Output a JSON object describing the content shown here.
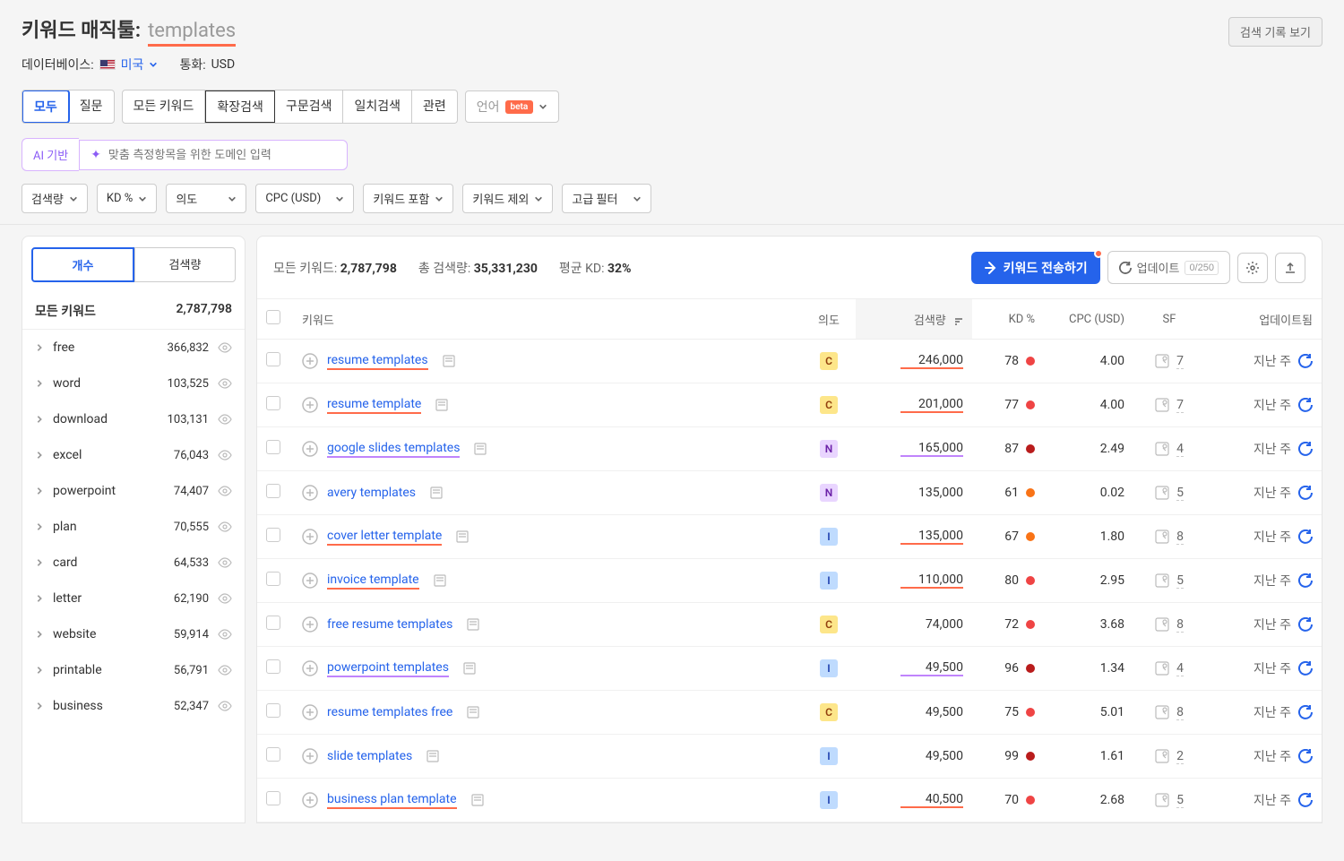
{
  "header": {
    "title_label": "키워드 매직툴:",
    "title_value": "templates",
    "history_btn": "검색 기록 보기",
    "db_label": "데이터베이스:",
    "db_value": "미국",
    "currency_label": "통화:",
    "currency_value": "USD"
  },
  "tabs": {
    "group1": [
      "모두",
      "질문"
    ],
    "group2": [
      "모든 키워드",
      "확장검색",
      "구문검색",
      "일치검색",
      "관련"
    ],
    "lang_label": "언어",
    "beta": "beta"
  },
  "ai": {
    "label": "AI 기반",
    "placeholder": "맞춤 측정항목을 위한 도메인 입력"
  },
  "filters": {
    "volume": "검색량",
    "kd": "KD %",
    "intent": "의도",
    "cpc": "CPC (USD)",
    "include": "키워드 포함",
    "exclude": "키워드 제외",
    "advanced": "고급 필터"
  },
  "sidebar": {
    "tab_count": "개수",
    "tab_volume": "검색량",
    "header_label": "모든 키워드",
    "header_count": "2,787,798",
    "items": [
      {
        "name": "free",
        "count": "366,832"
      },
      {
        "name": "word",
        "count": "103,525"
      },
      {
        "name": "download",
        "count": "103,131"
      },
      {
        "name": "excel",
        "count": "76,043"
      },
      {
        "name": "powerpoint",
        "count": "74,407"
      },
      {
        "name": "plan",
        "count": "70,555"
      },
      {
        "name": "card",
        "count": "64,533"
      },
      {
        "name": "letter",
        "count": "62,190"
      },
      {
        "name": "website",
        "count": "59,914"
      },
      {
        "name": "printable",
        "count": "56,791"
      },
      {
        "name": "business",
        "count": "52,347"
      }
    ]
  },
  "stats": {
    "all_kw_label": "모든 키워드:",
    "all_kw_value": "2,787,798",
    "total_vol_label": "총 검색량:",
    "total_vol_value": "35,331,230",
    "avg_kd_label": "평균 KD:",
    "avg_kd_value": "32%"
  },
  "actions": {
    "send": "키워드 전송하기",
    "update": "업데이트",
    "update_count": "0/250"
  },
  "columns": {
    "keyword": "키워드",
    "intent": "의도",
    "volume": "검색량",
    "kd": "KD %",
    "cpc": "CPC (USD)",
    "sf": "SF",
    "updated": "업데이트됨"
  },
  "rows": [
    {
      "keyword": "resume templates",
      "intent": "C",
      "volume": "246,000",
      "kd": "78",
      "kdClass": "kd-red",
      "cpc": "4.00",
      "sf": "7",
      "updated": "지난 주",
      "ul": "u-orange"
    },
    {
      "keyword": "resume template",
      "intent": "C",
      "volume": "201,000",
      "kd": "77",
      "kdClass": "kd-red",
      "cpc": "4.00",
      "sf": "7",
      "updated": "지난 주",
      "ul": "u-orange"
    },
    {
      "keyword": "google slides templates",
      "intent": "N",
      "volume": "165,000",
      "kd": "87",
      "kdClass": "kd-darkred",
      "cpc": "2.49",
      "sf": "4",
      "updated": "지난 주",
      "ul": "u-purple"
    },
    {
      "keyword": "avery templates",
      "intent": "N",
      "volume": "135,000",
      "kd": "61",
      "kdClass": "kd-orange",
      "cpc": "0.02",
      "sf": "5",
      "updated": "지난 주",
      "ul": ""
    },
    {
      "keyword": "cover letter template",
      "intent": "I",
      "volume": "135,000",
      "kd": "67",
      "kdClass": "kd-orange",
      "cpc": "1.80",
      "sf": "8",
      "updated": "지난 주",
      "ul": "u-orange"
    },
    {
      "keyword": "invoice template",
      "intent": "I",
      "volume": "110,000",
      "kd": "80",
      "kdClass": "kd-red",
      "cpc": "2.95",
      "sf": "5",
      "updated": "지난 주",
      "ul": "u-orange"
    },
    {
      "keyword": "free resume templates",
      "intent": "C",
      "volume": "74,000",
      "kd": "72",
      "kdClass": "kd-red",
      "cpc": "3.68",
      "sf": "8",
      "updated": "지난 주",
      "ul": ""
    },
    {
      "keyword": "powerpoint templates",
      "intent": "I",
      "volume": "49,500",
      "kd": "96",
      "kdClass": "kd-darkred",
      "cpc": "1.34",
      "sf": "4",
      "updated": "지난 주",
      "ul": "u-purple"
    },
    {
      "keyword": "resume templates free",
      "intent": "C",
      "volume": "49,500",
      "kd": "75",
      "kdClass": "kd-red",
      "cpc": "5.01",
      "sf": "8",
      "updated": "지난 주",
      "ul": ""
    },
    {
      "keyword": "slide templates",
      "intent": "I",
      "volume": "49,500",
      "kd": "99",
      "kdClass": "kd-darkred",
      "cpc": "1.61",
      "sf": "2",
      "updated": "지난 주",
      "ul": ""
    },
    {
      "keyword": "business plan template",
      "intent": "I",
      "volume": "40,500",
      "kd": "70",
      "kdClass": "kd-red",
      "cpc": "2.68",
      "sf": "5",
      "updated": "지난 주",
      "ul": "u-orange"
    }
  ]
}
